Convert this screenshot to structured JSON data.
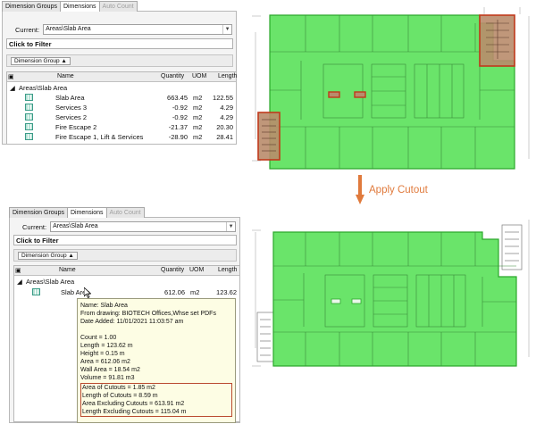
{
  "colors": {
    "slab_fill": "#4ee04e",
    "slab_stroke": "#2ca82c",
    "cutout_fill": "#b98c6c",
    "cutout_stroke": "#c0391b",
    "arrow": "#e07a3c",
    "tooltip_bg": "#fdfde4"
  },
  "top_panel": {
    "tabs": [
      "Dimension Groups",
      "Dimensions",
      "Auto Count"
    ],
    "current_label": "Current:",
    "current_value": "Areas\\Slab Area",
    "filter": "Click to Filter",
    "group_chip": "Dimension Group",
    "headers": {
      "name": "Name",
      "quantity": "Quantity",
      "uom": "UOM",
      "length": "Length"
    },
    "group_label": "Areas\\Slab Area",
    "rows": [
      {
        "name": "Slab Area",
        "quantity": "663.45",
        "uom": "m2",
        "length": "122.55"
      },
      {
        "name": "Services 3",
        "quantity": "-0.92",
        "uom": "m2",
        "length": "4.29"
      },
      {
        "name": "Services 2",
        "quantity": "-0.92",
        "uom": "m2",
        "length": "4.29"
      },
      {
        "name": "Fire Escape 2",
        "quantity": "-21.37",
        "uom": "m2",
        "length": "20.30"
      },
      {
        "name": "Fire Escape 1, Lift & Services",
        "quantity": "-28.90",
        "uom": "m2",
        "length": "28.41"
      }
    ]
  },
  "bottom_panel": {
    "tabs": [
      "Dimension Groups",
      "Dimensions",
      "Auto Count"
    ],
    "current_label": "Current:",
    "current_value": "Areas\\Slab Area",
    "filter": "Click to Filter",
    "group_chip": "Dimension Group",
    "headers": {
      "name": "Name",
      "quantity": "Quantity",
      "uom": "UOM",
      "length": "Length"
    },
    "group_label": "Areas\\Slab Area",
    "rows": [
      {
        "name": "Slab Area",
        "quantity": "612.06",
        "uom": "m2",
        "length": "123.62"
      }
    ]
  },
  "tooltip": {
    "name": "Name: Slab Area",
    "drawing": "From drawing: BIOTECH Offices,Whse set PDFs",
    "date": "Date Added: 11/01/2021 11:03:57 am",
    "count": "Count = 1.00",
    "length": "Length = 123.62 m",
    "height": "Height = 0.15 m",
    "area": "Area = 612.06 m2",
    "wall_area": "Wall Area = 18.54 m2",
    "volume": "Volume = 91.81 m3",
    "area_cutouts": "Area of Cutouts = 1.85 m2",
    "length_cutouts": "Length of Cutouts = 8.59 m",
    "area_excl": "Area Excluding Cutouts = 613.91 m2",
    "length_excl": "Length Excluding Cutouts = 115.04 m"
  },
  "apply_label": "Apply Cutout"
}
